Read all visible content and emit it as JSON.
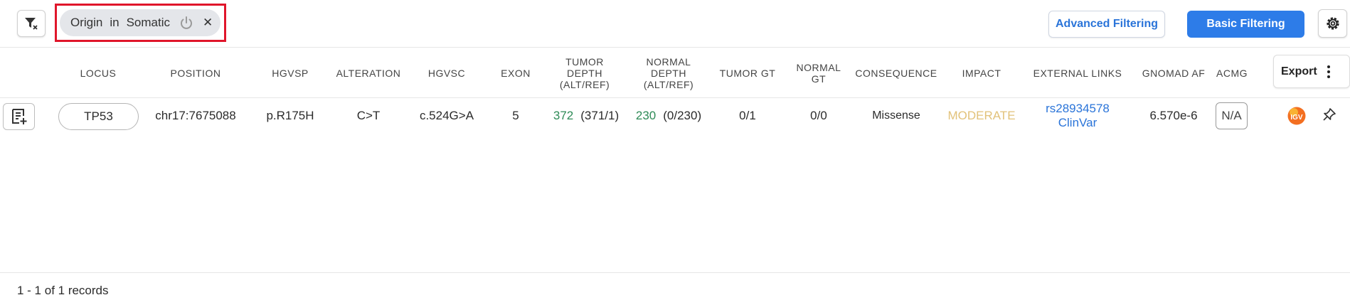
{
  "toolbar": {
    "filter_chip": {
      "field": "Origin",
      "operator": "in",
      "value": "Somatic"
    },
    "advanced_filtering_label": "Advanced Filtering",
    "basic_filtering_label": "Basic Filtering",
    "icons": {
      "clear_filters": "filter-clear-icon",
      "chip_toggle": "power-icon",
      "chip_remove": "close-icon",
      "settings": "gear-icon"
    }
  },
  "table": {
    "columns": [
      {
        "key": "locus",
        "label": "LOCUS"
      },
      {
        "key": "position",
        "label": "POSITION"
      },
      {
        "key": "hgvsp",
        "label": "HGVSP"
      },
      {
        "key": "alteration",
        "label": "ALTERATION"
      },
      {
        "key": "hgvsc",
        "label": "HGVSC"
      },
      {
        "key": "exon",
        "label": "EXON"
      },
      {
        "key": "tumor_depth",
        "label": "TUMOR DEPTH (ALT/REF)"
      },
      {
        "key": "normal_depth",
        "label": "NORMAL DEPTH (ALT/REF)"
      },
      {
        "key": "tumor_gt",
        "label": "TUMOR GT"
      },
      {
        "key": "normal_gt",
        "label": "NORMAL GT"
      },
      {
        "key": "consequence",
        "label": "CONSEQUENCE"
      },
      {
        "key": "impact",
        "label": "IMPACT"
      },
      {
        "key": "external_links",
        "label": "EXTERNAL LINKS"
      },
      {
        "key": "gnomad_af",
        "label": "GNOMAD AF"
      },
      {
        "key": "acmg",
        "label": "ACMG"
      }
    ],
    "export_label": "Export",
    "rows": [
      {
        "locus": "TP53",
        "position": "chr17:7675088",
        "hgvsp": "p.R175H",
        "alteration": "C>T",
        "hgvsc": "c.524G>A",
        "exon": "5",
        "tumor_depth_total": "372",
        "tumor_depth_alt_ref": "(371/1)",
        "normal_depth_total": "230",
        "normal_depth_alt_ref": "(0/230)",
        "tumor_gt": "0/1",
        "normal_gt": "0/0",
        "consequence": "Missense",
        "impact": "MODERATE",
        "external_links": [
          "rs28934578",
          "ClinVar"
        ],
        "gnomad_af": "6.570e-6",
        "acmg": "N/A",
        "icons": {
          "add_row": "add-to-report-icon",
          "igv": "igv-logo-icon",
          "pin": "pin-icon"
        }
      }
    ]
  },
  "footer": {
    "records_label": "1 - 1 of 1 records"
  },
  "colors": {
    "accent": "#2d7ce8",
    "link": "#2a74d9",
    "depth_green": "#2e8b57",
    "impact_moderate": "#e2c27a",
    "highlight_red": "#e0162b",
    "chip_bg": "#e4e6ea"
  }
}
